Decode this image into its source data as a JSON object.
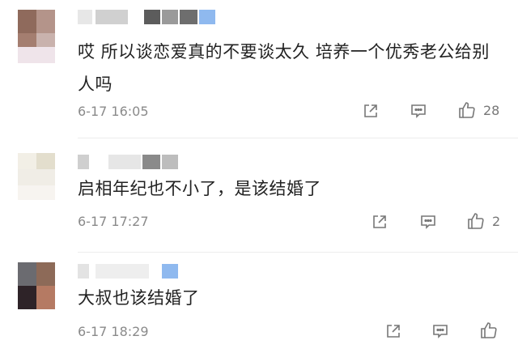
{
  "comments": [
    {
      "text": "哎 所以谈恋爱真的不要谈太久 培养一个优秀老公给别人吗",
      "time": "6-17 16:05",
      "likes": "28"
    },
    {
      "text": "启相年纪也不小了，是该结婚了",
      "time": "6-17 17:27",
      "likes": "2"
    },
    {
      "text": "大叔也该结婚了",
      "time": "6-17 18:29",
      "likes": ""
    }
  ],
  "icons": {
    "share": "share-icon",
    "reply": "comment-icon",
    "like": "thumbs-up-icon"
  }
}
